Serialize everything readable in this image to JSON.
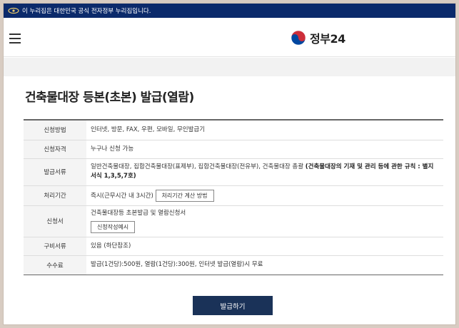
{
  "banner": {
    "text": "이 누리집은 대한민국 공식 전자정부 누리집입니다."
  },
  "header": {
    "logo_text": "정부24"
  },
  "page": {
    "title": "건축물대장 등본(초본) 발급(열람)"
  },
  "info_rows": [
    {
      "label": "신청방법",
      "value": "인터넷, 방문, FAX, 우편, 모바일, 무인발급기"
    },
    {
      "label": "신청자격",
      "value": "누구나 신청 가능"
    },
    {
      "label": "발급서류",
      "value": "일반건축물대장, 집합건축물대장(표제부), 집합건축물대장(전유부), 건축물대장 총괄 ",
      "value_bold": "(건축물대장의 기재 및 관리 등에 관한 규칙 : 별지서식 1,3,5,7호)"
    },
    {
      "label": "처리기간",
      "value": "즉시(근무시간 내 3시간)",
      "button": "처리기간 계산 방법"
    },
    {
      "label": "신청서",
      "value": "건축물대장등 초본발급 및 열람신청서",
      "button": "신청작성예시"
    },
    {
      "label": "구비서류",
      "value": "있음 (하단참조)"
    },
    {
      "label": "수수료",
      "value": "발급(1건당):500원, 열람(1건당):300원, 인터넷 발급(열람)시 무료"
    }
  ],
  "actions": {
    "issue_label": "발급하기"
  },
  "colors": {
    "banner_bg": "#0b2a6b",
    "primary_button": "#1a3258",
    "logo_red": "#cd2e3a",
    "logo_blue": "#0047a0"
  },
  "icons": {
    "banner": "government-emblem-icon",
    "menu": "hamburger-menu-icon",
    "logo": "taegeuk-logo-icon"
  }
}
